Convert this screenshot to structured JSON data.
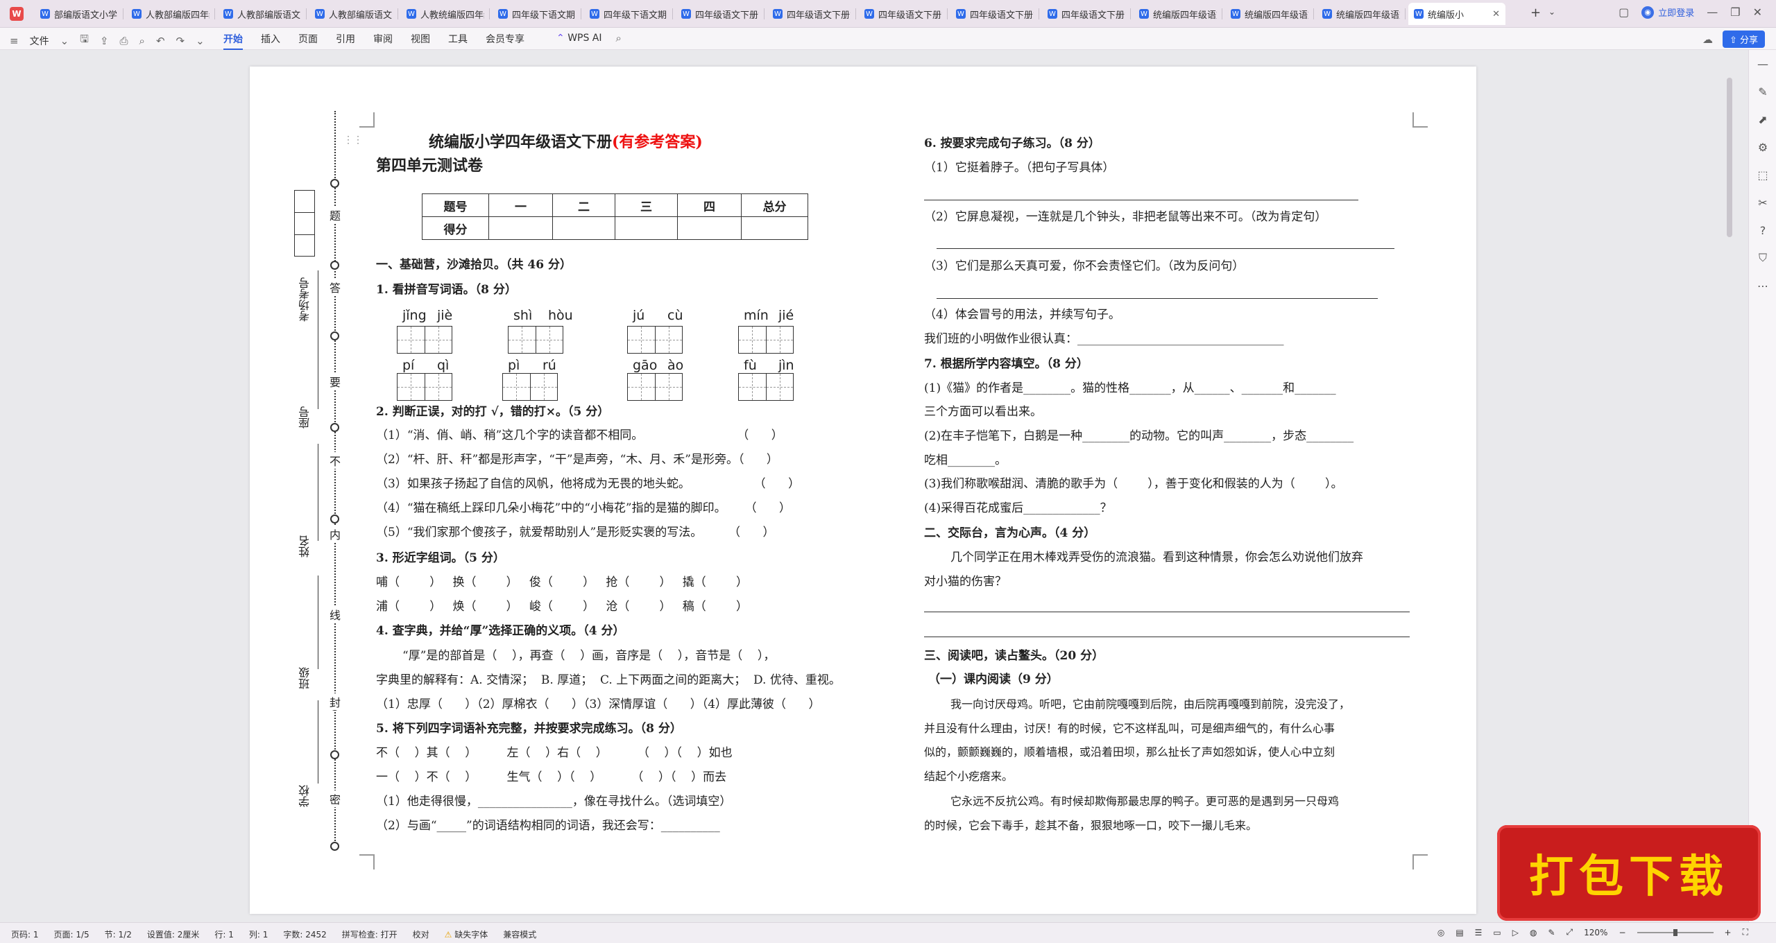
{
  "app": {
    "logo": "W"
  },
  "tabs": [
    {
      "label": "部编版语文小学四"
    },
    {
      "label": "人教部编版四年级"
    },
    {
      "label": "人教部编版语文四"
    },
    {
      "label": "人教部编版语文四"
    },
    {
      "label": "人教统编版四年级"
    },
    {
      "label": "四年级下语文期中"
    },
    {
      "label": "四年级下语文期中"
    },
    {
      "label": "四年级语文下册第"
    },
    {
      "label": "四年级语文下册第"
    },
    {
      "label": "四年级语文下册第"
    },
    {
      "label": "四年级语文下册第"
    },
    {
      "label": "四年级语文下册第"
    },
    {
      "label": "统编版四年级语文"
    },
    {
      "label": "统编版四年级语文"
    },
    {
      "label": "统编版四年级语文"
    },
    {
      "label": "统编版小"
    }
  ],
  "window": {
    "login": "立即登录",
    "share": "分享"
  },
  "menu": {
    "file": "文件",
    "tabs": [
      "开始",
      "插入",
      "页面",
      "引用",
      "审阅",
      "视图",
      "工具",
      "会员专享"
    ],
    "ai": "WPS AI"
  },
  "doc": {
    "title_main": "统编版小学四年级语文下册",
    "title_red": "(有参考答案)",
    "subtitle": "第四单元测试卷",
    "score_table": {
      "row1": [
        "题号",
        "一",
        "二",
        "三",
        "四",
        "总分"
      ],
      "row2": [
        "得分",
        "",
        "",
        "",
        "",
        ""
      ]
    },
    "binding": {
      "chars": [
        "题",
        "答",
        "要",
        "不",
        "内",
        "线",
        "封",
        "密"
      ],
      "labels": [
        "考场考号",
        "座号",
        "姓名",
        "班级",
        "学校"
      ]
    },
    "left": {
      "s1": "一、基础营，沙滩拾贝。（共 46 分）",
      "q1": "1. 看拼音写词语。（8 分）",
      "pinyin": [
        [
          "jǐng",
          "jiè"
        ],
        [
          "shì",
          "hòu"
        ],
        [
          "jú",
          "cù"
        ],
        [
          "mín",
          "jié"
        ],
        [
          "pí",
          "qì"
        ],
        [
          "pì",
          "rú"
        ],
        [
          "gāo",
          "ào"
        ],
        [
          "fù",
          "jìn"
        ]
      ],
      "q2": "2. 判断正误，对的打 √，错的打×。（5 分）",
      "q2_items": [
        "（1）“消、俏、峭、稍”这几个字的读音都不相同。                         （      ）",
        "（2）“杆、肝、秆”都是形声字，“干”是声旁，“木、月、禾”是形旁。（      ）",
        "（3）如果孩子扬起了自信的风帆，他将成为无畏的地头蛇。                 （      ）",
        "（4）“猫在稿纸上踩印几朵小梅花”中的“小梅花”指的是猫的脚印。     （      ）",
        "（5）“我们家那个傻孩子，就爱帮助别人”是形贬实褒的写法。       （      ）"
      ],
      "q3": "3. 形近字组词。（5 分）",
      "q3_rows": [
        "哺（        ）   换（        ）   俊（        ）   抢（        ）   撬（        ）",
        "浦（        ）   焕（        ）   峻（        ）   沧（        ）   稿（        ）"
      ],
      "q4": "4. 查字典，并给“厚”选择正确的义项。（4 分）",
      "q4_lines": [
        "“厚”是的部首是（    ），再查（    ）画，音序是（    ），音节是（    ），",
        "字典里的解释有：A. 交情深；  B. 厚道；  C. 上下两面之间的距离大；  D. 优待、重视。",
        "（1）忠厚（      ）（2）厚棉衣（      ）（3）深情厚谊（      ）（4）厚此薄彼（      ）"
      ],
      "q5": "5. 将下列四字词语补充完整，并按要求完成练习。（8 分）",
      "q5_lines": [
        "不（    ）其（    ）        左（    ）右（    ）        （    ）（    ）如也",
        "一（    ）不（    ）        生气（    ）（    ）        （    ）（    ）而去",
        "（1）他走得很慢，________________，像在寻找什么。（选词填空）",
        "（2）与画“_____”的词语结构相同的词语，我还会写：__________"
      ]
    },
    "right": {
      "q6": "6. 按要求完成句子练习。（8 分）",
      "q6_lines": [
        "（1）它挺着脖子。（把句子写具体）",
        "（2）它屏息凝视，一连就是几个钟头，非把老鼠等出来不可。（改为肯定句）",
        "（3）它们是那么天真可爱，你不会责怪它们。（改为反问句）",
        "（4）体会冒号的用法，并续写句子。",
        "我们班的小明做作业很认真：___________________________________"
      ],
      "q7": "7. 根据所学内容填空。（8 分）",
      "q7_lines": [
        "(1)《猫》的作者是________。猫的性格_______，从______、_______和_______",
        "三个方面可以看出来。",
        "(2)在丰子恺笔下，白鹅是一种________的动物。它的叫声________，步态________",
        "吃相________。",
        "(3)我们称歌喉甜润、清脆的歌手为（        ），善于变化和假装的人为（        ）。",
        "(4)采得百花成蜜后_____________？"
      ],
      "s2": "二、交际台，言为心声。（4 分）",
      "s2_lines": [
        "几个同学正在用木棒戏弄受伤的流浪猫。看到这种情景，你会怎么劝说他们放弃",
        "对小猫的伤害？"
      ],
      "s3": "三、阅读吧，读占鳌头。（20 分）",
      "s3_sub": "（一）课内阅读（9 分）",
      "reading": [
        "我一向讨厌母鸡。听吧，它由前院嘎嘎到后院，由后院再嘎嘎到前院，没完没了，",
        "并且没有什么理由，讨厌！有的时候，它不这样乱叫，可是细声细气的，有什么心事",
        "似的，颤颤巍巍的，顺着墙根，或沿着田坝，那么扯长了声如怨如诉，使人心中立刻",
        "结起个小疙瘩来。",
        "它永远不反抗公鸡。有时候却欺侮那最忠厚的鸭子。更可恶的是遇到另一只母鸡",
        "的时候，它会下毒手，趁其不备，狠狠地啄一口，咬下一撮儿毛来。"
      ]
    }
  },
  "status": {
    "items": [
      "页码: 1",
      "页面: 1/5",
      "节: 1/2",
      "设置值: 2厘米",
      "行: 1",
      "列: 1",
      "字数: 2452",
      "拼写检查: 打开",
      "校对",
      "缺失字体",
      "兼容模式"
    ],
    "zoom": "120%"
  },
  "banner": {
    "text": "打包下载"
  },
  "colors": {
    "accent": "#2f5fdc",
    "banner_bg": "#c91d1d",
    "banner_text": "#ffd400",
    "title_red": "#e11111"
  }
}
